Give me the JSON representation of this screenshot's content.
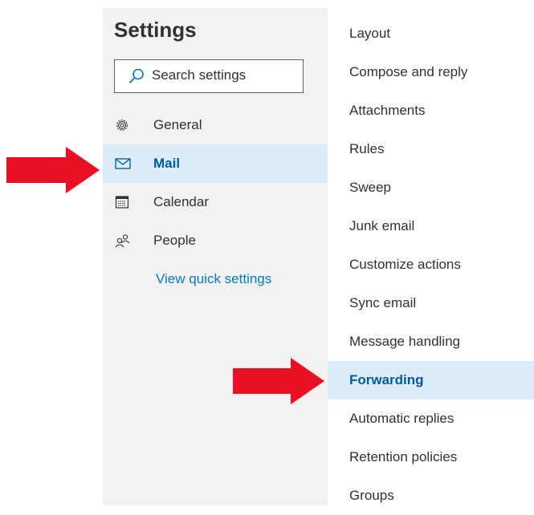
{
  "settings": {
    "title": "Settings",
    "search_placeholder": "Search settings"
  },
  "nav": {
    "items": [
      {
        "label": "General",
        "icon": "gear-icon",
        "selected": false
      },
      {
        "label": "Mail",
        "icon": "mail-icon",
        "selected": true
      },
      {
        "label": "Calendar",
        "icon": "calendar-icon",
        "selected": false
      },
      {
        "label": "People",
        "icon": "people-icon",
        "selected": false
      }
    ],
    "quick_settings_link": "View quick settings"
  },
  "mail_settings": {
    "items": [
      {
        "label": "Layout",
        "selected": false
      },
      {
        "label": "Compose and reply",
        "selected": false
      },
      {
        "label": "Attachments",
        "selected": false
      },
      {
        "label": "Rules",
        "selected": false
      },
      {
        "label": "Sweep",
        "selected": false
      },
      {
        "label": "Junk email",
        "selected": false
      },
      {
        "label": "Customize actions",
        "selected": false
      },
      {
        "label": "Sync email",
        "selected": false
      },
      {
        "label": "Message handling",
        "selected": false
      },
      {
        "label": "Forwarding",
        "selected": true
      },
      {
        "label": "Automatic replies",
        "selected": false
      },
      {
        "label": "Retention policies",
        "selected": false
      },
      {
        "label": "Groups",
        "selected": false
      }
    ]
  },
  "colors": {
    "left_pane_bg": "#f3f2f1",
    "selected_bg": "#deecf9",
    "selected_text": "#005a9e",
    "link": "#0078d4",
    "annotation_arrow": "#e81123"
  },
  "annotations": [
    {
      "icon": "red-arrow-icon",
      "points_to": "Mail"
    },
    {
      "icon": "red-arrow-icon",
      "points_to": "Forwarding"
    }
  ]
}
